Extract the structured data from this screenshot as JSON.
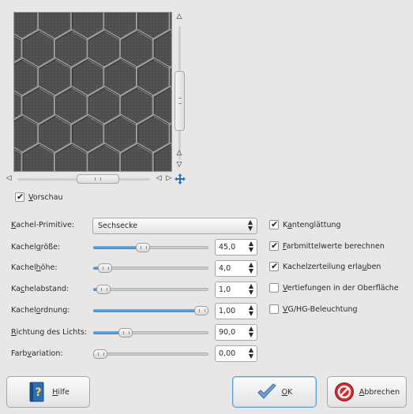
{
  "preview": {
    "checkbox_label": "Vorschau",
    "checked": true
  },
  "fields": {
    "primitive_label": "Kachel-Primitive:",
    "primitive_value": "Sechsecke",
    "tile_size_label": "Kachelgröße:",
    "tile_size_value": "45,0",
    "tile_size_fraction": 0.42,
    "tile_height_label": "Kachelhöhe:",
    "tile_height_value": "4,0",
    "tile_height_fraction": 0.05,
    "tile_spacing_label": "Kachelabstand:",
    "tile_spacing_value": "1,0",
    "tile_spacing_fraction": 0.03,
    "tile_neatness_label": "Kachelordnung:",
    "tile_neatness_value": "1,00",
    "tile_neatness_fraction": 1.0,
    "light_direction_label": "Richtung des Lichts:",
    "light_direction_value": "90,0",
    "light_direction_fraction": 0.25,
    "color_variation_label": "Farbvariation:",
    "color_variation_value": "0,00",
    "color_variation_fraction": 0.0
  },
  "options": [
    {
      "label": "Kantenglättung",
      "checked": true
    },
    {
      "label": "Farbmittelwerte berechnen",
      "checked": true
    },
    {
      "label": "Kachelzerteilung erlauben",
      "checked": true
    },
    {
      "label": "Vertiefungen in der Oberfläche",
      "checked": false
    },
    {
      "label": "VG/HG-Beleuchtung",
      "checked": false
    }
  ],
  "buttons": {
    "help": "Hilfe",
    "ok": "OK",
    "cancel": "Abbrechen"
  },
  "colors": {
    "accent": "#3d8bd0",
    "preview_bg": "#4e4e4e"
  }
}
